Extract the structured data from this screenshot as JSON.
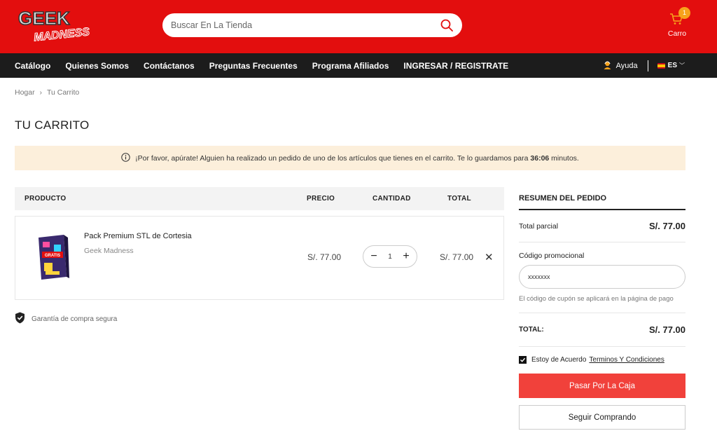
{
  "header": {
    "logo_top": "GEEK",
    "logo_bottom": "MADNESS",
    "search_placeholder": "Buscar En La Tienda",
    "search_icon": "search-icon",
    "cart": {
      "count": "1",
      "label": "Carro",
      "icon": "cart-icon"
    }
  },
  "nav": {
    "items": [
      {
        "label": "Catálogo"
      },
      {
        "label": "Quienes Somos"
      },
      {
        "label": "Contáctanos"
      },
      {
        "label": "Preguntas Frecuentes"
      },
      {
        "label": "Programa Afiliados"
      },
      {
        "label": "INGRESAR / REGISTRATE"
      }
    ],
    "help_label": "Ayuda",
    "language": "ES"
  },
  "breadcrumb": {
    "home": "Hogar",
    "current": "Tu Carrito"
  },
  "page_title": "TU CARRITO",
  "notice": {
    "text_before": "¡Por favor, apúrate! Alguien ha realizado un pedido de uno de los artículos que tienes en el carrito. Te lo guardamos para ",
    "timer": "36:06",
    "text_after": " minutos."
  },
  "table": {
    "headers": {
      "product": "PRODUCTO",
      "price": "PRECIO",
      "quantity": "CANTIDAD",
      "total": "TOTAL"
    },
    "items": [
      {
        "name": "Pack Premium STL de Cortesia",
        "vendor": "Geek Madness",
        "price": "S/. 77.00",
        "quantity": "1",
        "total": "S/. 77.00",
        "thumb_text": "GRATIS"
      }
    ]
  },
  "guarantee": "Garantía de compra segura",
  "summary": {
    "title": "RESUMEN DEL PEDIDO",
    "subtotal_label": "Total parcial",
    "subtotal_value": "S/. 77.00",
    "promo_label": "Código promocional",
    "promo_value": "xxxxxxx",
    "promo_note": "El código de cupón se aplicará en la página de pago",
    "total_label": "TOTAL:",
    "total_value": "S/. 77.00",
    "agree_text": "Estoy de Acuerdo",
    "terms_link": "Terminos Y Condiciones",
    "checkout_button": "Pasar Por La Caja",
    "continue_button": "Seguir Comprando"
  },
  "colors": {
    "brand_red": "#e30e0e",
    "nav_dark": "#1c1c1c",
    "notice_bg": "#fcefdb",
    "checkout_red": "#f1413b",
    "badge_orange": "#f7a21b"
  }
}
